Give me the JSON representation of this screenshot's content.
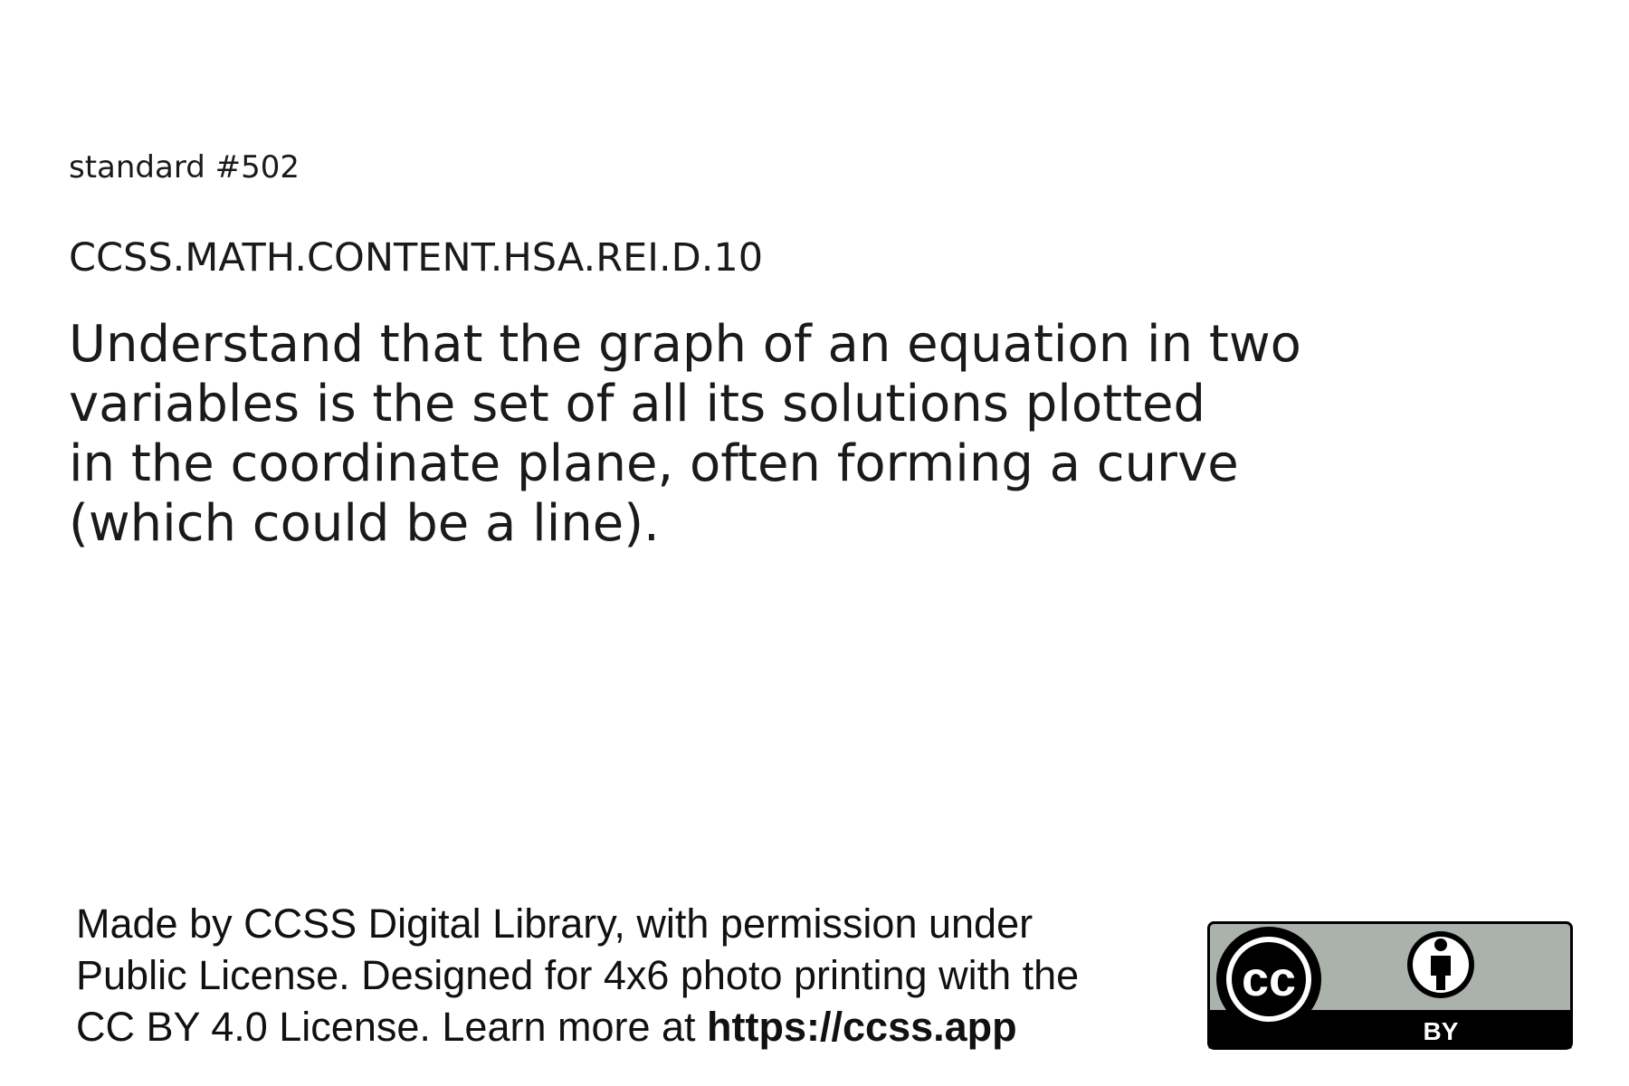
{
  "standard": {
    "number_label": "standard #502",
    "code": "CCSS.MATH.CONTENT.HSA.REI.D.10",
    "text_lines": [
      "Understand that the graph of an equation in two",
      "variables is the set of all its solutions plotted",
      "in the coordinate plane, often forming a curve",
      "(which could be a line)."
    ]
  },
  "footer": {
    "line1": "Made by CCSS Digital Library, with permission under",
    "line2": "Public License. Designed for 4x6 photo printing with the",
    "line3_prefix": "CC BY 4.0 License. Learn more at ",
    "link_text": "https://ccss.app"
  },
  "license_badge": {
    "cc_label": "cc",
    "by_label": "BY",
    "icon_names": [
      "cc-logo-icon",
      "attribution-person-icon"
    ],
    "colors": {
      "badge_top": "#aab2ab",
      "badge_bottom": "#000000",
      "badge_border": "#000000",
      "logo_fill": "#ffffff"
    }
  }
}
